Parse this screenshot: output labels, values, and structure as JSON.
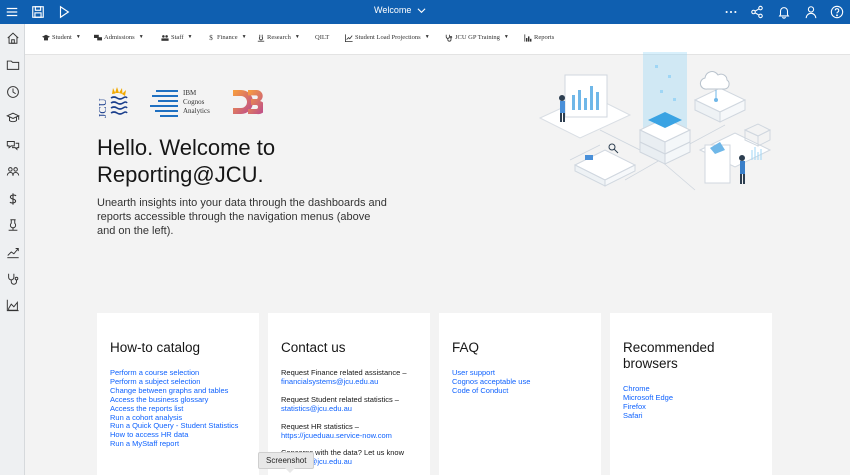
{
  "topbar": {
    "title": "Welcome",
    "icons": [
      "hamburger-icon",
      "save-icon",
      "play-icon",
      "more-icon",
      "share-icon",
      "notifications-icon",
      "user-icon",
      "help-icon"
    ]
  },
  "leftrail": {
    "icons": [
      "home-icon",
      "folder-icon",
      "recent-icon",
      "student-icon",
      "admissions-icon",
      "staff-icon",
      "finance-icon",
      "research-icon",
      "trend-icon",
      "stethoscope-icon",
      "area-chart-icon"
    ]
  },
  "menubar": {
    "items": [
      {
        "label": "Student",
        "icon": "student-icon",
        "dropdown": true
      },
      {
        "label": "Admissions",
        "icon": "admissions-icon",
        "dropdown": true
      },
      {
        "label": "Staff",
        "icon": "staff-icon",
        "dropdown": true
      },
      {
        "label": "Finance",
        "icon": "dollar-icon",
        "dropdown": true
      },
      {
        "label": "Research",
        "icon": "research-icon",
        "dropdown": true
      },
      {
        "label": "QILT",
        "icon": "",
        "dropdown": false
      },
      {
        "label": "Student Load Projections",
        "icon": "trend-icon",
        "dropdown": true
      },
      {
        "label": "JCU GP Training",
        "icon": "stethoscope-icon",
        "dropdown": true
      },
      {
        "label": "Reports",
        "icon": "bar-chart-icon",
        "dropdown": false
      }
    ]
  },
  "logos": {
    "cognos_lines": [
      "IBM",
      "Cognos",
      "Analytics"
    ],
    "jcu_letters": "JCU",
    "d3_letters": "D3"
  },
  "hero": {
    "heading": "Hello. Welcome to Reporting@JCU.",
    "intro": "Unearth insights into your data through the dashboards and reports accessible through the navigation menus (above and on the left)."
  },
  "cards": {
    "howto": {
      "title": "How-to catalog",
      "links": [
        "Perform a course selection",
        "Perform a subject selection",
        "Change between graphs and tables",
        "Access the business glossary",
        "Access the reports list",
        "Run a cohort analysis",
        "Run a Quick Query - Student Statistics",
        "How to access HR data",
        "Run a MyStaff report"
      ]
    },
    "contact": {
      "title": "Contact us",
      "finance_text": "Request Finance related assistance –",
      "finance_email": "financialsystems@jcu.edu.au",
      "student_text": "Request Student related statistics –",
      "student_email": "statistics@jcu.edu.au",
      "hr_text": "Request HR statistics –",
      "hr_link": "https://jcueduau.service-now.com",
      "data_text": "Concerns with the data? Let us know",
      "data_email": "statistics@jcu.edu.au"
    },
    "faq": {
      "title": "FAQ",
      "links": [
        "User support",
        "Cognos acceptable use",
        "Code of Conduct"
      ]
    },
    "browsers": {
      "title": "Recommended browsers",
      "links": [
        "Chrome",
        "Microsoft Edge",
        "Firefox",
        "Safari"
      ]
    }
  },
  "tooltip": {
    "text": "Screenshot"
  },
  "colors": {
    "topbar": "#0f5fb0",
    "link": "#0f62fe",
    "jcu_blue": "#1a3e8c",
    "d3_orange": "#f28b30"
  }
}
